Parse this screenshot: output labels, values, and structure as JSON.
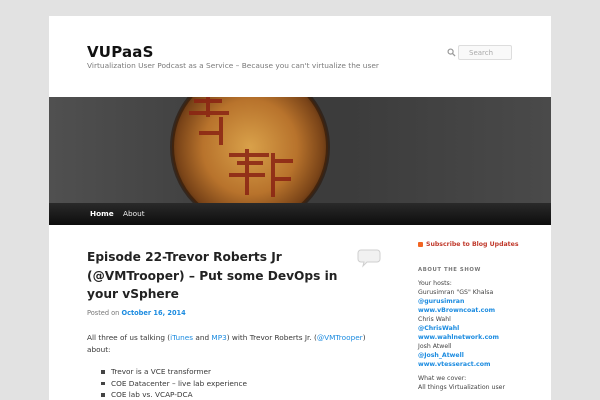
{
  "site": {
    "title": "VUPaaS",
    "description": "Virtualization User Podcast as a Service – Because you can't virtualize the user"
  },
  "search": {
    "placeholder": "Search"
  },
  "nav": [
    {
      "label": "Home",
      "active": true
    },
    {
      "label": "About",
      "active": false
    }
  ],
  "post": {
    "title": "Episode 22-Trevor Roberts Jr (@VMTrooper) – Put some DevOps in your vSphere",
    "posted_prefix": "Posted on",
    "date": "October 16, 2014",
    "intro_1": "All three of us talking (",
    "itunes": "iTunes",
    "and": " and ",
    "mp3": "MP3",
    "intro_2": ") with Trevor Roberts Jr. (",
    "vmtrooper": "@VMTrooper",
    "intro_3": ") about:",
    "bullets": [
      "Trevor is a VCE transformer",
      "COE Datacenter – live lab experience",
      "COE lab vs. VCAP-DCA"
    ]
  },
  "sidebar": {
    "subscribe": "Subscribe to Blog Updates",
    "about_heading": "ABOUT THE SHOW",
    "hosts_label": "Your hosts:",
    "host1_name": "Gurusimran \"GS\" Khalsa",
    "host1_handle": "@gurusimran",
    "host1_site": "www.vBrowncoat.com",
    "host2_name": "Chris Wahl",
    "host2_handle": "@ChrisWahl",
    "host2_site": "www.wahlnetwork.com",
    "host3_name": "Josh Atwell",
    "host3_handle": "@Josh_Atwell",
    "host3_site": "www.vtesseract.com",
    "cover_label": "What we cover:",
    "cover_item": "All things Virtualization user"
  },
  "colors": {
    "link": "#1b8be0",
    "nav_bg": "#1a1a1a",
    "subscribe": "#c0392b",
    "rss": "#f26522"
  }
}
